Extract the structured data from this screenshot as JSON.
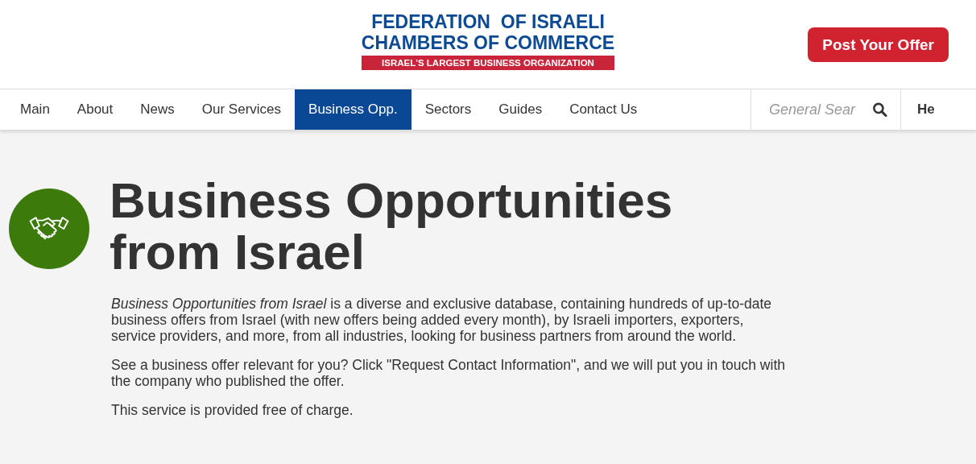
{
  "header": {
    "logo": {
      "line_1": "FEDERATION  OF ISRAELI",
      "line_2": "CHAMBERS OF COMMERCE",
      "tagline": "ISRAEL'S LARGEST BUSINESS ORGANIZATION"
    },
    "cta": "Post Your Offer"
  },
  "nav": {
    "items": [
      {
        "label": "Main",
        "selected": false
      },
      {
        "label": "About",
        "selected": false
      },
      {
        "label": "News",
        "selected": false
      },
      {
        "label": "Our Services",
        "selected": false
      },
      {
        "label": "Business Opp.",
        "selected": true
      },
      {
        "label": "Sectors",
        "selected": false
      },
      {
        "label": "Guides",
        "selected": false
      },
      {
        "label": "Contact Us",
        "selected": false
      }
    ],
    "search": {
      "placeholder": "General Sear"
    },
    "language": "He"
  },
  "intro": {
    "title": "Business Opportunities from Israel",
    "paragraphs": [
      "*Business Opportunities from Israel* is a diverse and exclusive database, containing hundreds of up-to-date business offers from Israel (with new offers being added every month), by Israeli importers, exporters, service providers, and more, from all industries, looking for business partners from around the world.",
      " See a business offer relevant for you? Click \"Request Contact Information\", and we will put you in touch with the company who published the offer.",
      " This service is provided free of charge."
    ]
  }
}
